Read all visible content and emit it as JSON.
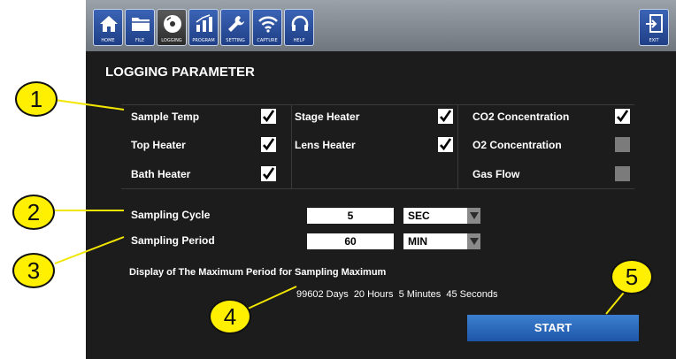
{
  "toolbar": {
    "items": [
      {
        "label": "HOME",
        "icon": "home-icon"
      },
      {
        "label": "FILE",
        "icon": "folder-icon"
      },
      {
        "label": "LOGGING",
        "icon": "disc-icon"
      },
      {
        "label": "PROGRAM",
        "icon": "bar-chart-icon"
      },
      {
        "label": "SETTING",
        "icon": "wrench-icon"
      },
      {
        "label": "CAPTURE",
        "icon": "wifi-icon"
      },
      {
        "label": "HELP",
        "icon": "headset-icon"
      }
    ],
    "exit_label": "EXIT"
  },
  "page": {
    "title": "LOGGING PARAMETER"
  },
  "parameters": {
    "sample_temp": {
      "label": "Sample Temp",
      "checked": true
    },
    "stage_heater": {
      "label": "Stage Heater",
      "checked": true
    },
    "co2": {
      "label": "CO2 Concentration",
      "checked": true
    },
    "top_heater": {
      "label": "Top Heater",
      "checked": true
    },
    "lens_heater": {
      "label": "Lens Heater",
      "checked": true
    },
    "o2": {
      "label": "O2 Concentration",
      "checked": false
    },
    "bath_heater": {
      "label": "Bath Heater",
      "checked": true
    },
    "gas_flow": {
      "label": "Gas Flow",
      "checked": false
    }
  },
  "sampling": {
    "cycle_label": "Sampling Cycle",
    "cycle_value": "5",
    "cycle_unit": "SEC",
    "period_label": "Sampling Period",
    "period_value": "60",
    "period_unit": "MIN"
  },
  "max_period": {
    "label": "Display of The Maximum Period for Sampling Maximum",
    "value": "99602 Days  20 Hours  5 Minutes  45 Seconds"
  },
  "start_label": "START",
  "callouts": [
    "1",
    "2",
    "3",
    "4",
    "5"
  ],
  "colors": {
    "callout": "#ffef00",
    "button": "#2a6bc4",
    "background": "#1c1c1c"
  }
}
